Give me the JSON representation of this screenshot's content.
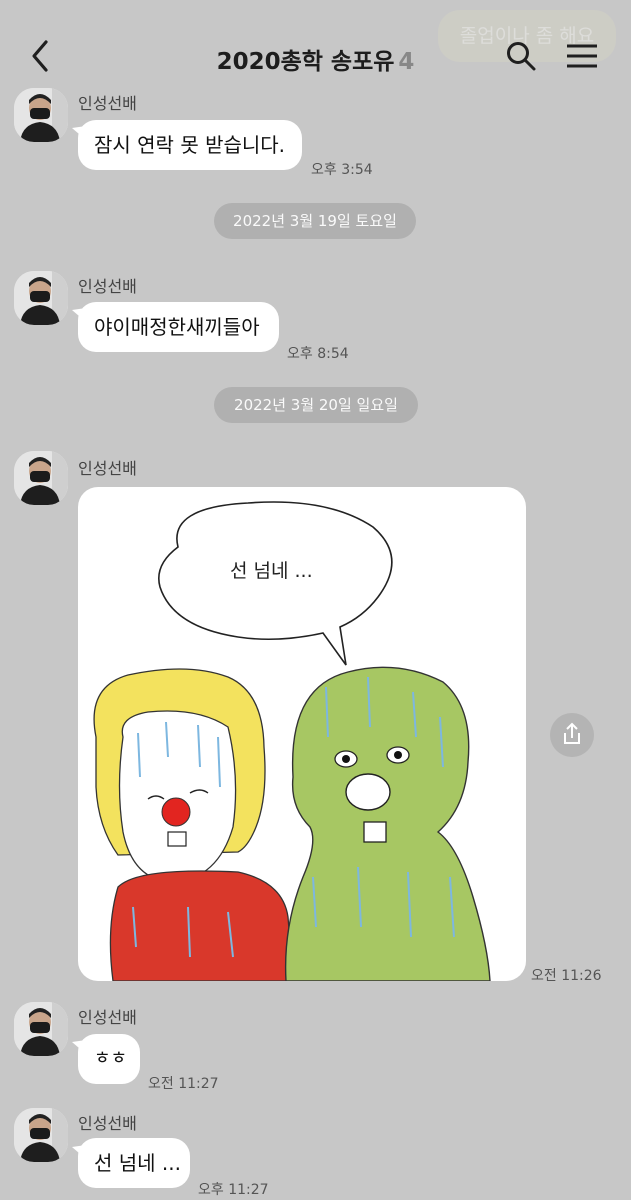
{
  "header": {
    "title": "2020총학 송포유",
    "member_count": "4",
    "ghost_preview": "졸업이나 좀 해요"
  },
  "messages": [
    {
      "sender": "인성선배",
      "text": "잠시 연락 못 받습니다.",
      "time": "오후 3:54"
    },
    {
      "sender": "인성선배",
      "text": "야이매정한새끼들아",
      "time": "오후 8:54"
    },
    {
      "sender": "인성선배",
      "image_caption": "선 넘네 ...",
      "time": "오전 11:26"
    },
    {
      "sender": "인성선배",
      "text": "ㅎㅎ",
      "time": "오전 11:27"
    },
    {
      "sender": "인성선배",
      "text": "선 넘네 ...",
      "time": "오후 11:27"
    }
  ],
  "dates": [
    "2022년 3월 19일 토요일",
    "2022년 3월 20일 일요일"
  ],
  "icons": {
    "back": "chevron-left-icon",
    "search": "search-icon",
    "menu": "hamburger-menu-icon",
    "share": "share-icon"
  },
  "colors": {
    "background": "#c7c7c7",
    "bubble": "#ffffff",
    "date_pill": "#b0b0b0"
  }
}
